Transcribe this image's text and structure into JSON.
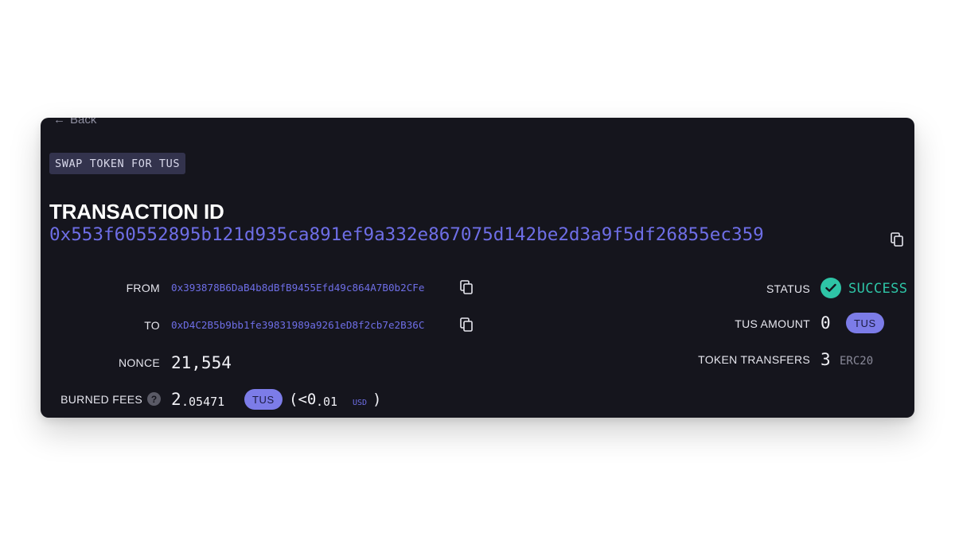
{
  "back_label": "Back",
  "tag": "SWAP TOKEN FOR TUS",
  "transaction": {
    "label": "TRANSACTION ID",
    "hash": "0x553f60552895b121d935ca891ef9a332e867075d142be2d3a9f5df26855ec359"
  },
  "from": {
    "label": "FROM",
    "address": "0x393878B6DaB4b8dBfB9455Efd49c864A7B0b2CFe"
  },
  "to": {
    "label": "TO",
    "address": "0xD4C2B5b9bb1fe39831989a9261eD8f2cb7e2B36C"
  },
  "nonce": {
    "label": "NONCE",
    "value": "21,554"
  },
  "burned_fees": {
    "label": "BURNED FEES",
    "help": "?",
    "value_int": "2",
    "value_dec": ".05471",
    "token": "TUS",
    "usd_open": "(<0",
    "usd_dec": ".01",
    "usd_unit": "USD",
    "usd_close": ")"
  },
  "status": {
    "label": "STATUS",
    "value": "SUCCESS"
  },
  "tus_amount": {
    "label": "TUS AMOUNT",
    "value": "0",
    "token": "TUS"
  },
  "token_transfers": {
    "label": "TOKEN TRANSFERS",
    "value": "3",
    "standard": "ERC20"
  },
  "colors": {
    "card_bg": "#15151d",
    "accent": "#6e6ee6",
    "pill": "#7c7ce8",
    "success": "#2ec4a6"
  },
  "icons": [
    "back-arrow-icon",
    "copy-icon",
    "check-icon",
    "help-icon"
  ]
}
